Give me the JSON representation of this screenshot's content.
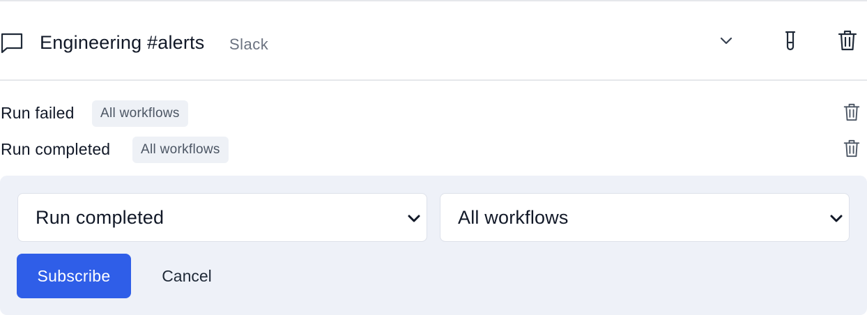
{
  "channel": {
    "icon": "chat-bubble-icon",
    "name": "Engineering #alerts",
    "type": "Slack",
    "actions": {
      "expand_icon": "chevron-down-icon",
      "test_icon": "test-tube-icon",
      "delete_icon": "trash-icon"
    }
  },
  "subscriptions": [
    {
      "event": "Run failed",
      "scope": "All workflows"
    },
    {
      "event": "Run completed",
      "scope": "All workflows"
    }
  ],
  "form": {
    "event_select": {
      "value": "Run completed"
    },
    "workflow_select": {
      "value": "All workflows"
    },
    "subscribe_label": "Subscribe",
    "cancel_label": "Cancel"
  },
  "colors": {
    "accent": "#2f5ee8",
    "panel_bg": "#eef1f8",
    "badge_bg": "#eef1f6",
    "muted_text": "#6b7280"
  }
}
